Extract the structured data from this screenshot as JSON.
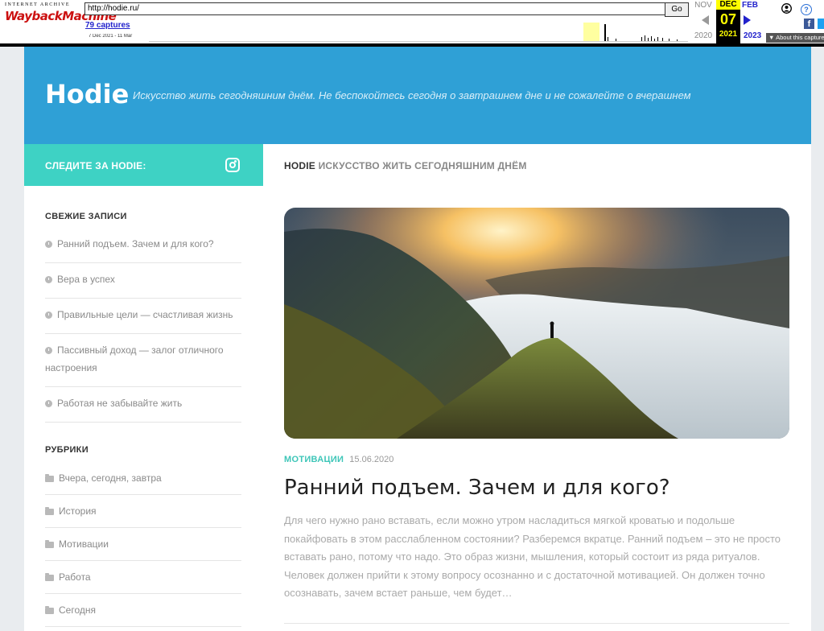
{
  "wayback": {
    "logo_top": "INTERNET ARCHIVE",
    "logo_main": "WaybackMachine",
    "url": "http://hodie.ru/",
    "go_label": "Go",
    "captures": "79 captures",
    "range": "7 Dec 2021 - 11 Mar",
    "prev_month": "NOV",
    "prev_year": "2020",
    "cur_month": "DEC",
    "cur_day": "07",
    "cur_year": "2021",
    "next_month": "FEB",
    "next_year": "2023",
    "about": "▼ About this capture",
    "help_glyph": "?",
    "fb_glyph": "f"
  },
  "site": {
    "title": "Hodie",
    "tagline": "Искусство жить сегодняшним днём. Не беспокойтесь сегодня о завтрашнем дне и не сожалейте о вчерашнем",
    "accent": "#2fa0d6",
    "teal": "#3ed2c4"
  },
  "follow": {
    "label": "СЛЕДИТЕ ЗА HODIE:",
    "icon": "instagram-icon"
  },
  "content_bar": {
    "brand": "HODIE",
    "text": "ИСКУССТВО ЖИТЬ СЕГОДНЯШНИМ ДНЁМ"
  },
  "sidebar": {
    "recent_title": "СВЕЖИЕ ЗАПИСИ",
    "recent": [
      "Ранний подъем. Зачем и для кого?",
      "Вера в успех",
      "Правильные цели — счастливая жизнь",
      "Пассивный доход — залог отличного настроения",
      "Работая не забывайте жить"
    ],
    "cats_title": "РУБРИКИ",
    "cats": [
      "Вчера, сегодня, завтра",
      "История",
      "Мотивации",
      "Работа",
      "Сегодня"
    ]
  },
  "post": {
    "category": "МОТИВАЦИИ",
    "date": "15.06.2020",
    "title": "Ранний подъем. Зачем и для кого?",
    "excerpt": "Для чего нужно рано вставать, если можно утром насладиться мягкой кроватью и подольше покайфовать в этом расслабленном состоянии? Разберемся вкратце. Ранний подъем – это не просто вставать рано, потому что надо. Это образ жизни, мышления, который состоит из ряда ритуалов. Человек должен прийти к этому вопросу осознанно и с достаточной мотивацией. Он должен точно осознавать, зачем встает раньше, чем будет…"
  }
}
